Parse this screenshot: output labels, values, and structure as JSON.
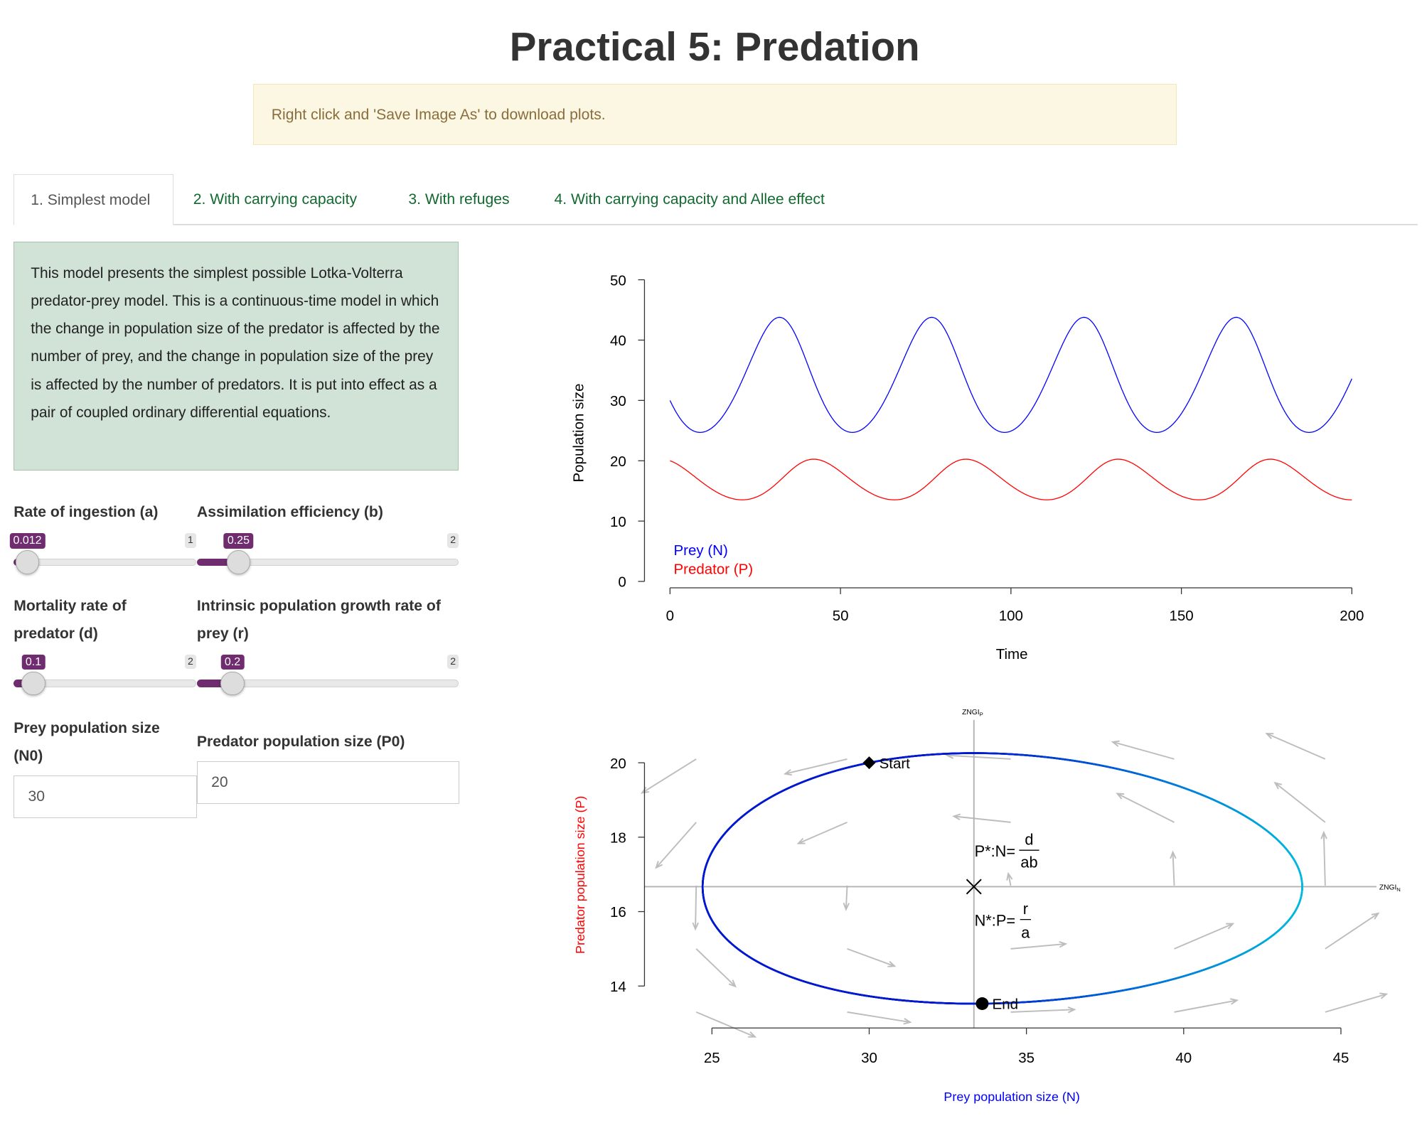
{
  "title": "Practical 5: Predation",
  "alert": "Right click and 'Save Image As' to download plots.",
  "tabs": [
    {
      "label": "1. Simplest model",
      "active": true
    },
    {
      "label": "2. With carrying capacity",
      "active": false
    },
    {
      "label": "3. With refuges",
      "active": false
    },
    {
      "label": "4. With carrying capacity and Allee effect",
      "active": false
    }
  ],
  "description": "This model presents the simplest possible Lotka-Volterra predator-prey model. This is a continuous-time model in which the change in population size of the predator is affected by the number of prey, and the change in population size of the prey is affected by the number of predators. It is put into effect as a pair of coupled ordinary differential equations.",
  "sliders": [
    {
      "id": "a",
      "label": "Rate of ingestion (a)",
      "value": 0.012,
      "max": 1,
      "display": "0.012",
      "max_label": "1"
    },
    {
      "id": "b",
      "label": "Assimilation efficiency (b)",
      "value": 0.25,
      "max": 2,
      "display": "0.25",
      "max_label": "2"
    },
    {
      "id": "d",
      "label": "Mortality rate of predator (d)",
      "value": 0.1,
      "max": 2,
      "display": "0.1",
      "max_label": "2"
    },
    {
      "id": "r",
      "label": "Intrinsic population growth rate of prey (r)",
      "value": 0.2,
      "max": 2,
      "display": "0.2",
      "max_label": "2"
    }
  ],
  "inputs": {
    "prey": {
      "label": "Prey population size (N0)",
      "value": "30"
    },
    "predator": {
      "label": "Predator population size (P0)",
      "value": "20"
    }
  },
  "colors": {
    "accent": "#6f2c6f",
    "tab_link": "#11692f",
    "prey": "#0000ff",
    "predator": "#ff0000",
    "zngi": "#b3b3b3",
    "arrows": "#bdbdbd"
  },
  "chart_data": [
    {
      "type": "line",
      "xlabel": "Time",
      "ylabel": "Population size",
      "xlim": [
        0,
        200
      ],
      "ylim": [
        0,
        50
      ],
      "xticks": [
        "0",
        "50",
        "100",
        "150",
        "200"
      ],
      "yticks": [
        "0",
        "10",
        "20",
        "30",
        "40",
        "50"
      ],
      "legend": [
        "Prey (N)",
        "Predator (P)"
      ],
      "legend_position": "bottom-left",
      "model": {
        "a": 0.012,
        "b": 0.25,
        "d": 0.1,
        "r": 0.2,
        "N0": 30,
        "P0": 20
      },
      "series": [
        {
          "name": "Prey (N)",
          "color": "#0000ff",
          "min": 24.8,
          "max": 43.8,
          "period": 44.5
        },
        {
          "name": "Predator (P)",
          "color": "#ff0000",
          "min": 13.6,
          "max": 20.2,
          "period": 44.5
        }
      ]
    },
    {
      "type": "line",
      "xlabel": "Prey population size (N)",
      "ylabel": "Predator population size (P)",
      "xlim": [
        25,
        45
      ],
      "ylim": [
        14,
        20
      ],
      "xticks": [
        "25",
        "30",
        "35",
        "40",
        "45"
      ],
      "yticks": [
        "14",
        "16",
        "18",
        "20"
      ],
      "zngi_p_label": "ZNGI",
      "zngi_p_sub": "P",
      "zngi_n_label": "ZNGI",
      "zngi_n_sub": "N",
      "equilibrium": {
        "N": 33.33,
        "P": 16.67
      },
      "annot_p": {
        "lhs": "P*:N=",
        "num": "d",
        "den": "ab"
      },
      "annot_n": {
        "lhs": "N*:P=",
        "num": "r",
        "den": "a"
      },
      "start_label": "Start",
      "end_label": "End",
      "start": {
        "N": 30,
        "P": 20
      },
      "end": {
        "N": 32.4,
        "P": 13.55
      },
      "gradient": [
        "#0018d0",
        "#00bde0"
      ]
    }
  ]
}
